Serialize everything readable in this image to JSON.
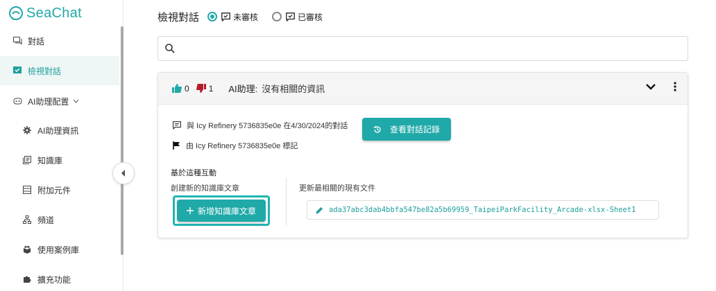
{
  "app": {
    "logo_text": "SeaChat",
    "accent": "#1fa9a8"
  },
  "sidebar": {
    "items": [
      {
        "label": "對話",
        "icon": "chat-bubbles-icon",
        "active": false
      },
      {
        "label": "檢視對話",
        "icon": "review-chat-icon",
        "active": true
      },
      {
        "label": "AI助理配置",
        "icon": "robot-icon",
        "active": false,
        "expandable": true
      },
      {
        "label": "AI助理資訊",
        "icon": "gear-icon",
        "active": false,
        "sub": true
      },
      {
        "label": "知識庫",
        "icon": "library-icon",
        "active": false,
        "sub": true
      },
      {
        "label": "附加元件",
        "icon": "widgets-icon",
        "active": false,
        "sub": true
      },
      {
        "label": "頻道",
        "icon": "channels-icon",
        "active": false,
        "sub": true
      },
      {
        "label": "使用案例庫",
        "icon": "box-icon",
        "active": false,
        "sub": true
      },
      {
        "label": "擴充功能",
        "icon": "puzzle-icon",
        "active": false,
        "sub": true
      }
    ]
  },
  "header": {
    "title": "檢視對話",
    "filter_unreviewed": "未審核",
    "filter_reviewed": "已審核",
    "selected": "未審核"
  },
  "search": {
    "placeholder": "",
    "value": ""
  },
  "card": {
    "likes": "0",
    "dislikes": "1",
    "ai_label": "AI助理:",
    "ai_answer": "沒有相關的資訊",
    "conversation_line": "與 Icy Refinery 5736835e0e 在4/30/2024的對話",
    "flag_line": "由 Icy Refinery 5736835e0e 標記",
    "view_history_button": "查看對話記錄",
    "section_title": "基於這種互動",
    "create_label": "創建新的知識庫文章",
    "add_button": "新增知識庫文章",
    "update_label": "更新最相關的現有文件",
    "related_doc": "ada37abc3dab4bbfa547be82a5b69959_TaipeiParkFacility_Arcade-xlsx-Sheet1"
  }
}
